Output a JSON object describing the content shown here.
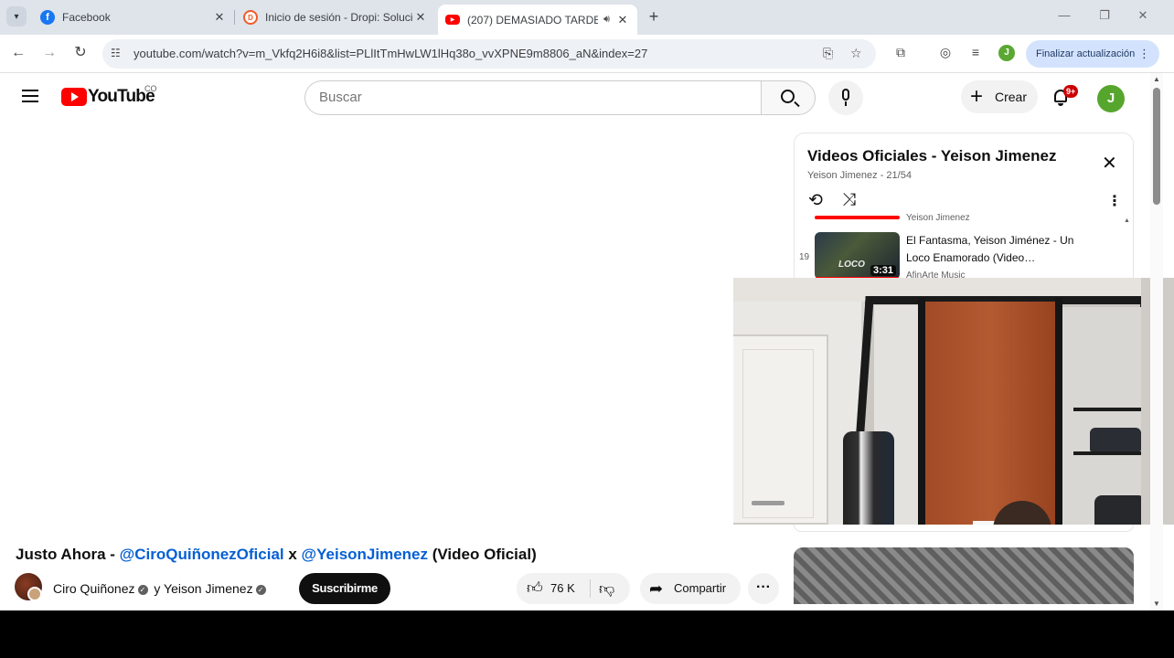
{
  "browser": {
    "tabs": [
      {
        "title": "Facebook",
        "favicon": "facebook-icon",
        "color": "#1877f2"
      },
      {
        "title": "Inicio de sesión - Dropi: Solucio",
        "favicon": "dropi-icon",
        "color": "#f15a29"
      },
      {
        "title": "(207) DEMASIADO TARDE (",
        "favicon": "youtube-icon",
        "color": "#ff0000",
        "active": true
      }
    ],
    "url": "youtube.com/watch?v=m_Vkfq2H6i8&list=PLlItTmHwLW1lHq38o_vvXPNE9m8806_aN&index=27",
    "update_button": "Finalizar actualización",
    "profile_initial": "J"
  },
  "header": {
    "logo_text": "YouTube",
    "country_code": "CO",
    "search_placeholder": "Buscar",
    "create_label": "Crear",
    "notifications_badge": "9+",
    "avatar_initial": "J"
  },
  "video": {
    "title_prefix": "Justo Ahora - ",
    "mention1": "@CiroQuiñonezOficial",
    "title_sep": " x ",
    "mention2": "@YeisonJimenez",
    "title_suffix": " (Video Oficial)",
    "channel1": "Ciro Quiñonez",
    "channel_join": " y ",
    "channel2": "Yeison Jimenez",
    "subscribe_label": "Suscribirme",
    "likes": "76 K",
    "share_label": "Compartir"
  },
  "playlist": {
    "title": "Videos Oficiales - Yeison Jimenez",
    "subtitle": "Yeison Jimenez - 21/54",
    "prev_channel": "Yeison Jimenez",
    "current": {
      "index": "19",
      "title": "El Fantasma, Yeison Jiménez - Un Loco Enamorado (Video…",
      "channel": "AfinArte Music",
      "duration": "3:31",
      "thumb_text": "LOCO"
    }
  },
  "colors": {
    "accent": "#065fd4",
    "brand": "#ff0000"
  }
}
